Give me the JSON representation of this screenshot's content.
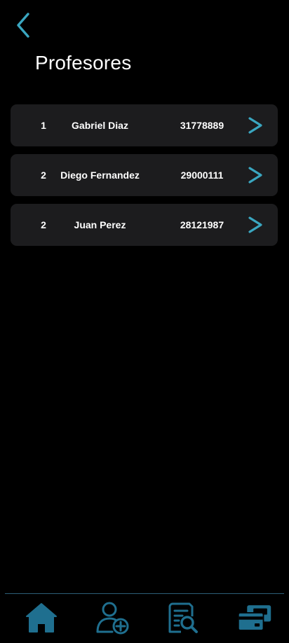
{
  "header": {
    "back_icon": "chevron-left-icon",
    "title": "Profesores"
  },
  "teachers": [
    {
      "number": "1",
      "name": "Gabriel Diaz",
      "id": "31778889"
    },
    {
      "number": "2",
      "name": "Diego Fernandez",
      "id": "29000111"
    },
    {
      "number": "2",
      "name": "Juan Perez",
      "id": "28121987"
    }
  ],
  "bottom_nav": {
    "items": [
      {
        "icon": "home-icon"
      },
      {
        "icon": "add-user-icon"
      },
      {
        "icon": "document-search-icon"
      },
      {
        "icon": "payment-cards-icon"
      }
    ]
  },
  "colors": {
    "background": "#000000",
    "card": "#1c1c1e",
    "accent": "#3aa6c0",
    "nav_icon": "#1f6f8f",
    "text": "#ffffff"
  }
}
